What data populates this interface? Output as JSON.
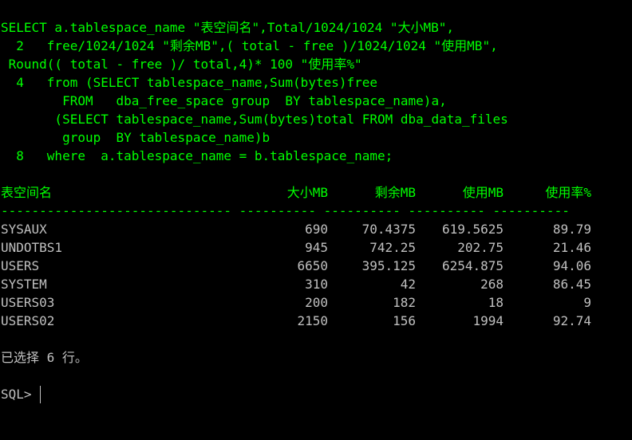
{
  "sql_lines": [
    "SELECT a.tablespace_name \"表空间名\",Total/1024/1024 \"大小MB\",",
    "  2   free/1024/1024 \"剩余MB\",( total - free )/1024/1024 \"使用MB\",",
    " Round(( total - free )/ total,4)* 100 \"使用率%\"",
    "  4   from (SELECT tablespace_name,Sum(bytes)free",
    "        FROM   dba_free_space group  BY tablespace_name)a,",
    "       (SELECT tablespace_name,Sum(bytes)total FROM dba_data_files",
    "        group  BY tablespace_name)b",
    "  8   where  a.tablespace_name = b.tablespace_name;"
  ],
  "result": {
    "headers": [
      "表空间名",
      "大小MB",
      "剩余MB",
      "使用MB",
      "使用率%"
    ],
    "separator": "------------------------------ ---------- ---------- ---------- ----------",
    "rows": [
      [
        "SYSAUX",
        "690",
        "70.4375",
        "619.5625",
        "89.79"
      ],
      [
        "UNDOTBS1",
        "945",
        "742.25",
        "202.75",
        "21.46"
      ],
      [
        "USERS",
        "6650",
        "395.125",
        "6254.875",
        "94.06"
      ],
      [
        "SYSTEM",
        "310",
        "42",
        "268",
        "86.45"
      ],
      [
        "USERS03",
        "200",
        "182",
        "18",
        "9"
      ],
      [
        "USERS02",
        "2150",
        "156",
        "1994",
        "92.74"
      ]
    ]
  },
  "status_message": "已选择 6 行。",
  "prompt": "SQL>",
  "colors": {
    "background": "#000000",
    "sql_text": "#00ff00",
    "output_text": "#c0c0c0"
  }
}
